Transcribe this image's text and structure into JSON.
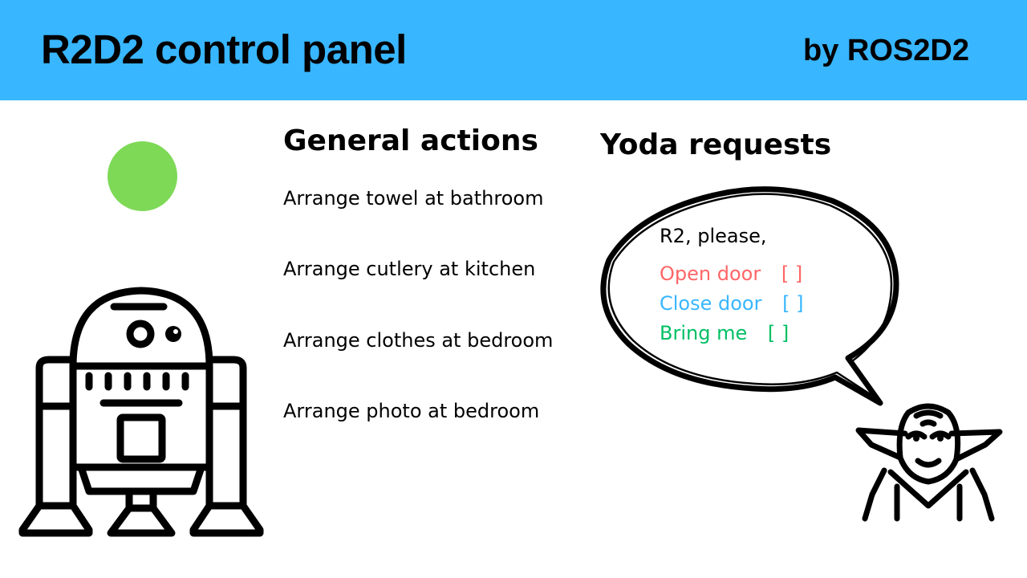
{
  "header": {
    "title": "R2D2 control panel",
    "byline": "by ROS2D2",
    "background": "#38b6ff"
  },
  "status": {
    "color": "#7ed957",
    "icon": "status-indicator-dot"
  },
  "icons": {
    "robot": "r2d2-icon",
    "yoda": "yoda-icon",
    "bubble": "speech-bubble-icon"
  },
  "general_actions": {
    "title": "General actions",
    "items": [
      "Arrange towel at bathroom",
      "Arrange cutlery at kitchen",
      "Arrange clothes at bedroom",
      "Arrange photo at bedroom"
    ]
  },
  "yoda_requests": {
    "title": "Yoda requests",
    "intro": "R2, please,",
    "items": [
      {
        "label": "Open door",
        "bracket": "[    ]",
        "color": "#ff6666"
      },
      {
        "label": "Close door",
        "bracket": "[    ]",
        "color": "#38b6ff"
      },
      {
        "label": "Bring me",
        "bracket": "[          ]",
        "color": "#00bf63"
      }
    ]
  }
}
